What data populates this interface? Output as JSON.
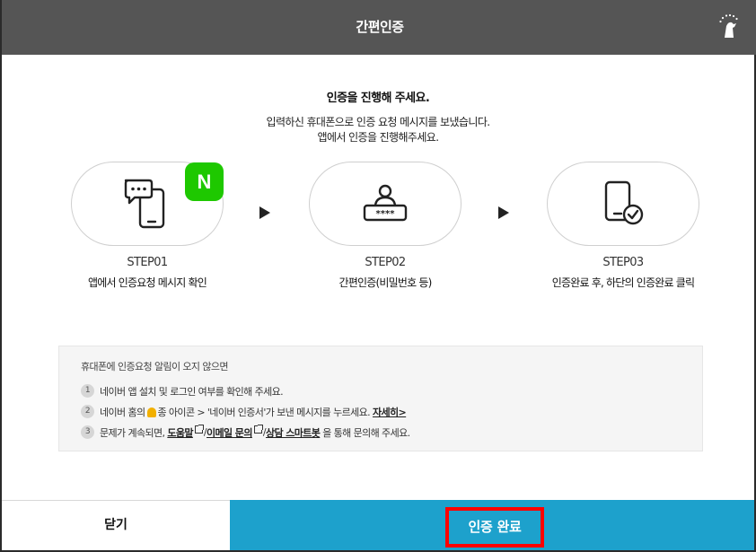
{
  "header": {
    "title": "간편인증"
  },
  "intro": {
    "title": "인증을 진행해 주세요.",
    "line1": "입력하신 휴대폰으로 인증 요청 메시지를 보냈습니다.",
    "line2": "앱에서 인증을 진행해주세요."
  },
  "steps": [
    {
      "label": "STEP01",
      "desc": "앱에서 인증요청 메시지 확인",
      "icon": "phone-message-icon"
    },
    {
      "label": "STEP02",
      "desc": "간편인증(비밀번호 등)",
      "icon": "password-user-icon"
    },
    {
      "label": "STEP03",
      "desc": "인증완료 후, 하단의 인증완료 클릭",
      "icon": "phone-check-icon"
    }
  ],
  "badge": {
    "letter": "N",
    "color": "#1ec800"
  },
  "notice": {
    "head": "휴대폰에 인증요청 알림이 오지 않으면",
    "items": [
      {
        "num": "1",
        "text": "네이버 앱 설치 및 로그인 여부를 확인해 주세요."
      },
      {
        "num": "2",
        "text_a": "네이버 홈의",
        "text_b": "종 아이콘 > '네이버 인증서'가 보낸 메시지를 누르세요.",
        "link": "자세히>"
      },
      {
        "num": "3",
        "text_a": "문제가 계속되면,",
        "link1": "도움말",
        "sep1": "/",
        "link2": "이메일 문의",
        "sep2": "/",
        "link3": "상담 스마트봇",
        "text_b": "을 통해 문의해 주세요."
      }
    ]
  },
  "footer": {
    "close_label": "닫기",
    "done_label": "인증 완료",
    "accent_color": "#1da1cc",
    "highlight_color": "#ff0000"
  }
}
